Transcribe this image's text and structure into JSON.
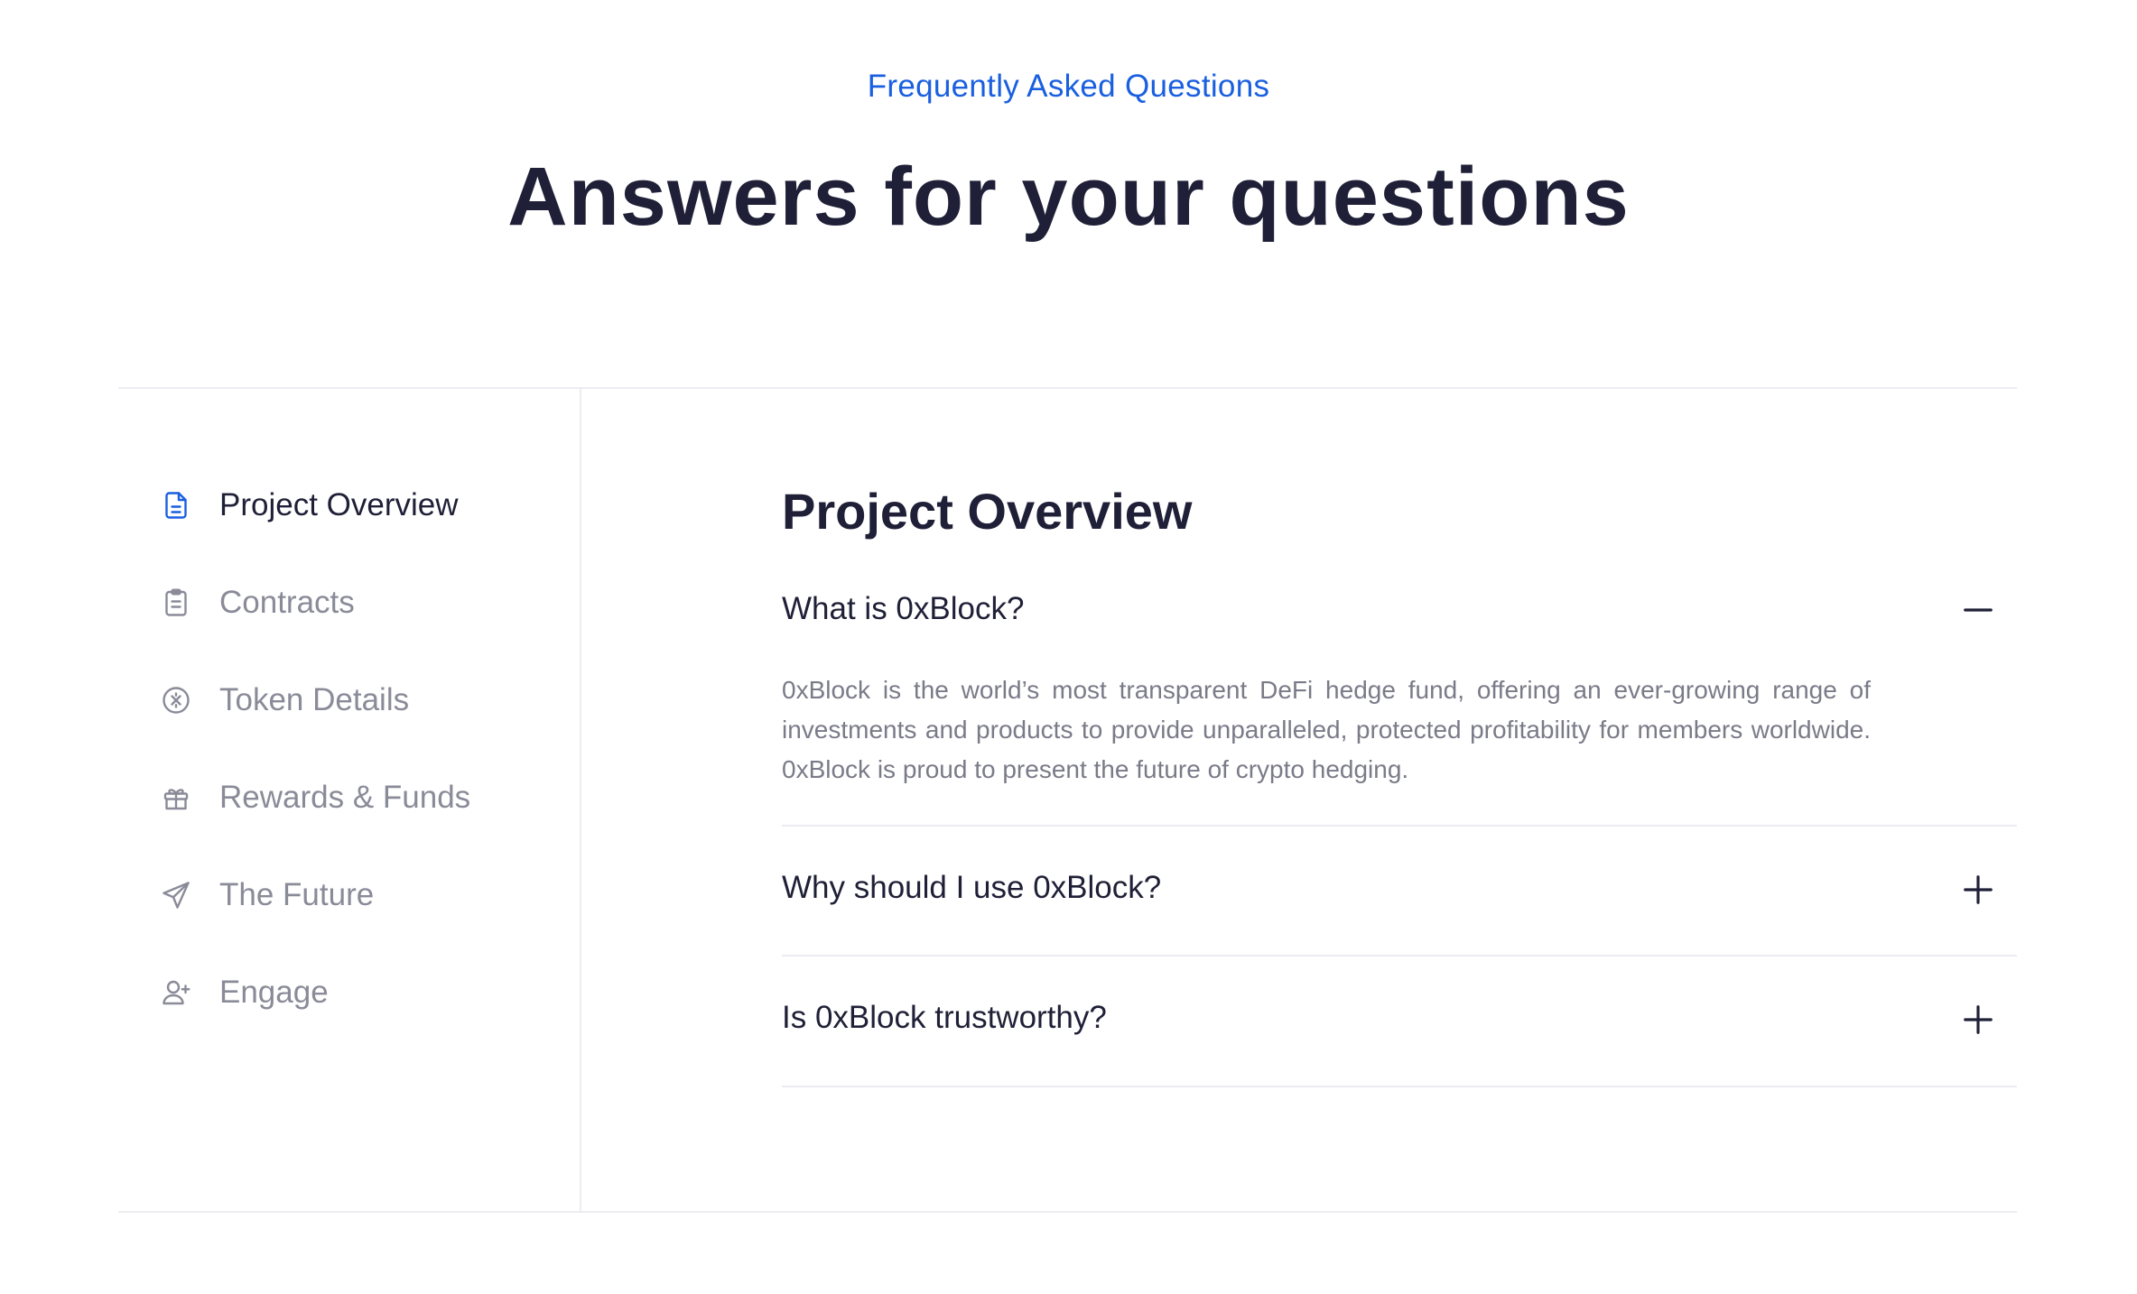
{
  "header": {
    "eyebrow": "Frequently Asked Questions",
    "title": "Answers for your questions"
  },
  "colors": {
    "accent": "#1a5fe0",
    "heading": "#1f2037",
    "muted": "#8a8b98",
    "divider": "#ececf1"
  },
  "sidebar": {
    "items": [
      {
        "label": "Project Overview",
        "icon": "document-icon",
        "active": true
      },
      {
        "label": "Contracts",
        "icon": "clipboard-icon",
        "active": false
      },
      {
        "label": "Token Details",
        "icon": "token-icon",
        "active": false
      },
      {
        "label": "Rewards & Funds",
        "icon": "gift-icon",
        "active": false
      },
      {
        "label": "The Future",
        "icon": "paper-plane-icon",
        "active": false
      },
      {
        "label": "Engage",
        "icon": "user-plus-icon",
        "active": false
      }
    ]
  },
  "main": {
    "section_title": "Project Overview",
    "faqs": [
      {
        "question": "What is 0xBlock?",
        "expanded": true,
        "answer": "0xBlock is the world’s most transparent DeFi hedge fund, offering an ever-growing range of investments and products to provide unparalleled, protected profitability for members worldwide. 0xBlock is proud to present the future of crypto hedging."
      },
      {
        "question": "Why should I use 0xBlock?",
        "expanded": false
      },
      {
        "question": "Is 0xBlock trustworthy?",
        "expanded": false
      }
    ]
  }
}
